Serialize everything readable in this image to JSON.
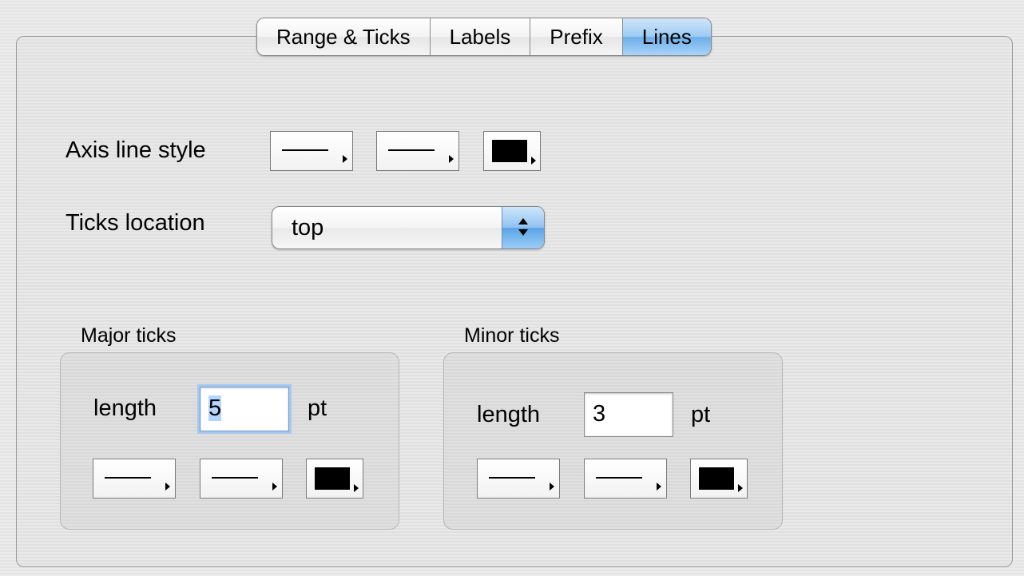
{
  "tabs": [
    {
      "label": "Range & Ticks",
      "active": false
    },
    {
      "label": "Labels",
      "active": false
    },
    {
      "label": "Prefix",
      "active": false
    },
    {
      "label": "Lines",
      "active": true
    }
  ],
  "axis_line_style": {
    "label": "Axis line style"
  },
  "ticks_location": {
    "label": "Ticks location",
    "value": "top"
  },
  "major_ticks": {
    "title": "Major ticks",
    "length_label": "length",
    "length_value": "5",
    "unit": "pt"
  },
  "minor_ticks": {
    "title": "Minor ticks",
    "length_label": "length",
    "length_value": "3",
    "unit": "pt"
  },
  "colors": {
    "accent": "#6daee9",
    "swatch": "#000000"
  }
}
